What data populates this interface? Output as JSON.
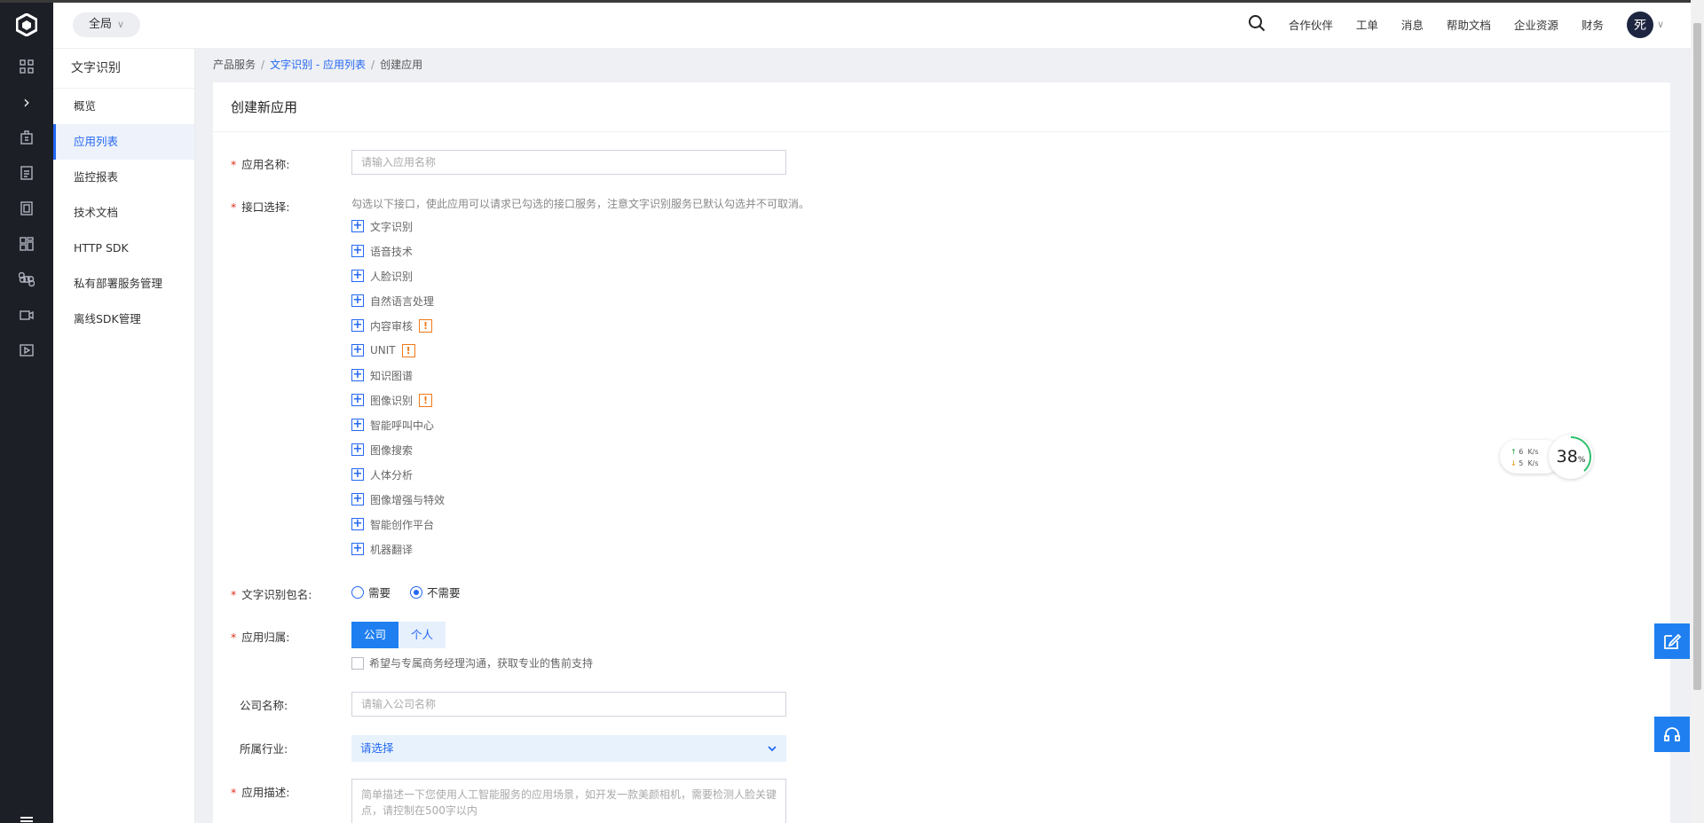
{
  "topbar": {
    "region": "全局",
    "nav": [
      "合作伙伴",
      "工单",
      "消息",
      "帮助文档",
      "企业资源",
      "财务"
    ],
    "avatar": "死"
  },
  "sidebar": {
    "title": "文字识别",
    "items": [
      {
        "label": "概览"
      },
      {
        "label": "应用列表"
      },
      {
        "label": "监控报表"
      },
      {
        "label": "技术文档"
      },
      {
        "label": "HTTP SDK"
      },
      {
        "label": "私有部署服务管理"
      },
      {
        "label": "离线SDK管理"
      }
    ]
  },
  "breadcrumb": {
    "root": "产品服务",
    "sep": "/",
    "link": "文字识别 - 应用列表",
    "current": "创建应用"
  },
  "form": {
    "title": "创建新应用",
    "req": "*",
    "name_label": "应用名称:",
    "name_placeholder": "请输入应用名称",
    "api_label": "接口选择:",
    "api_hint": "勾选以下接口，使此应用可以请求已勾选的接口服务，注意文字识别服务已默认勾选并不可取消。",
    "apis": [
      {
        "label": "文字识别",
        "warn": ""
      },
      {
        "label": "语音技术",
        "warn": ""
      },
      {
        "label": "人脸识别",
        "warn": ""
      },
      {
        "label": "自然语言处理",
        "warn": ""
      },
      {
        "label": "内容审核",
        "warn": "!"
      },
      {
        "label": "UNIT",
        "warn": "!"
      },
      {
        "label": "知识图谱",
        "warn": ""
      },
      {
        "label": "图像识别",
        "warn": "!"
      },
      {
        "label": "智能呼叫中心",
        "warn": ""
      },
      {
        "label": "图像搜索",
        "warn": ""
      },
      {
        "label": "人体分析",
        "warn": ""
      },
      {
        "label": "图像增强与特效",
        "warn": ""
      },
      {
        "label": "智能创作平台",
        "warn": ""
      },
      {
        "label": "机器翻译",
        "warn": ""
      }
    ],
    "package_label": "文字识别包名:",
    "package_options": [
      "需要",
      "不需要"
    ],
    "package_selected": "不需要",
    "owner_label": "应用归属:",
    "owner_options": [
      "公司",
      "个人"
    ],
    "owner_selected": "公司",
    "contact_checkbox": "希望与专属商务经理沟通，获取专业的售前支持",
    "company_label": "公司名称:",
    "company_placeholder": "请输入公司名称",
    "industry_label": "所属行业:",
    "industry_value": "请选择",
    "desc_label": "应用描述:",
    "desc_placeholder": "简单描述一下您使用人工智能服务的应用场景，如开发一款美颜相机，需要检测人脸关键点，请控制在500字以内"
  },
  "speed_widget": {
    "up": "6",
    "down": "5",
    "unit": "K/s",
    "percent": "38",
    "pct_sign": "%"
  },
  "colors": {
    "primary": "#2468f2",
    "rail": "#1d1f26",
    "required": "#e0301e",
    "warn": "#f07818"
  }
}
